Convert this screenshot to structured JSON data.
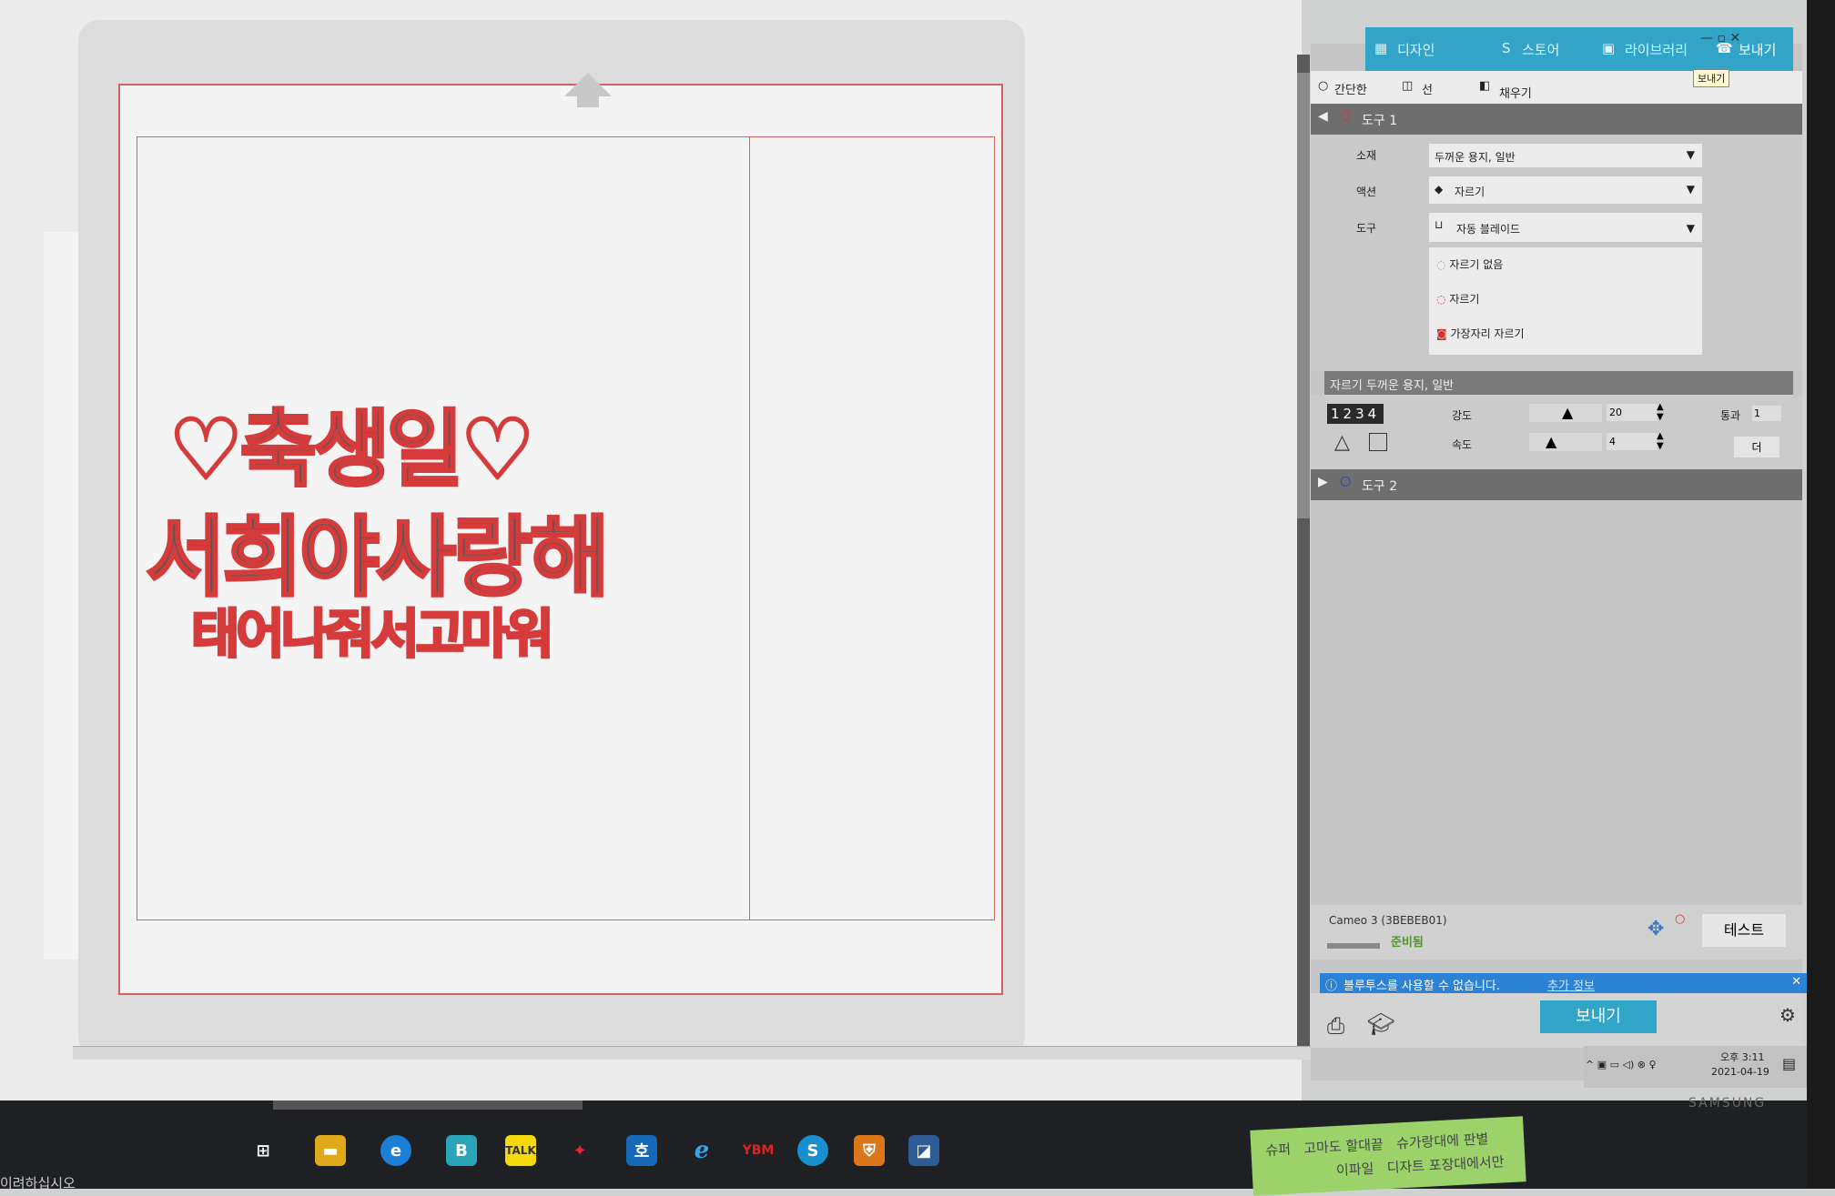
{
  "tabs": {
    "design": "디자인",
    "store": "스토어",
    "library": "라이브러리",
    "send": "보내기",
    "tooltip": "보내기"
  },
  "modes": {
    "simple": "간단한",
    "line": "선",
    "fill": "채우기"
  },
  "tool1": {
    "header": "도구 1",
    "material_label": "소재",
    "action_label": "액션",
    "tool_label": "도구",
    "material_value": "두꺼운 용지, 일반",
    "action_value": "자르기",
    "tool_value": "자동 블레이드",
    "opt_none": "자르기 없음",
    "opt_cut": "자르기",
    "opt_edge": "가장자리 자르기"
  },
  "settings": {
    "title": "자르기 두꺼운 용지, 일반",
    "blade": "1234",
    "force_label": "강도",
    "force_value": "20",
    "speed_label": "속도",
    "speed_value": "4",
    "passes_label": "통과",
    "passes_value": "1",
    "more": "더"
  },
  "tool2": {
    "header": "도구 2"
  },
  "device": {
    "name": "Cameo 3 (3BEBEB01)",
    "status": "준비됨",
    "test": "테스트"
  },
  "bluetooth": {
    "message": "블루투스를 사용할 수 없습니다.",
    "link": "추가 정보"
  },
  "send_button": "보내기",
  "clock": {
    "time": "오후 3:11",
    "date": "2021-04-19"
  },
  "taskbar": {
    "left_text": "이려하십시오"
  },
  "monitor_brand": "SAMSUNG",
  "design": {
    "line1": "♡축생일♡",
    "line2": "서희야사랑해",
    "line3": "태어나줘서고마워"
  },
  "sticky_note": {
    "line1": "슈퍼   고마도 할대끝   슈가랑대에 판별",
    "line2": "                이파일   디자트 포장대에서만"
  },
  "colors": {
    "accent": "#31a4c8",
    "cut": "#d63b3b"
  }
}
